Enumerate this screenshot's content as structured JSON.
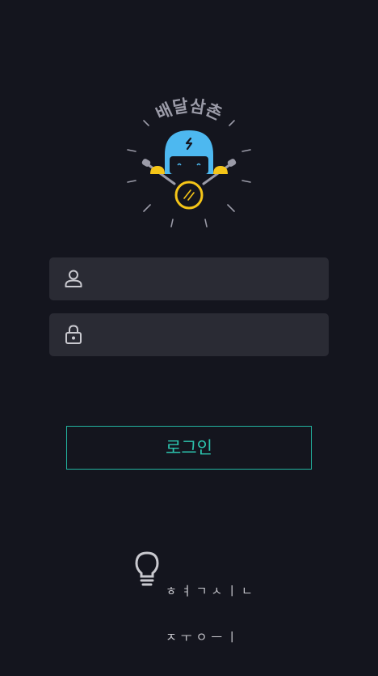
{
  "logo": {
    "app_name": "배달삼촌",
    "brand_color": "#4db8f0",
    "accent_color": "#f5c518"
  },
  "login_form": {
    "username_icon": "user-icon",
    "username_placeholder": "",
    "password_icon": "lock-icon",
    "password_placeholder": ""
  },
  "login_button": {
    "label": "로그인",
    "color": "#2cc4ae"
  },
  "footer": {
    "icon": "lightbulb-icon",
    "brand_line1": "ㅎㅕㄱㅅㅣㄴ",
    "brand_line2": "ㅈㅜㅇㅡㅣ"
  }
}
